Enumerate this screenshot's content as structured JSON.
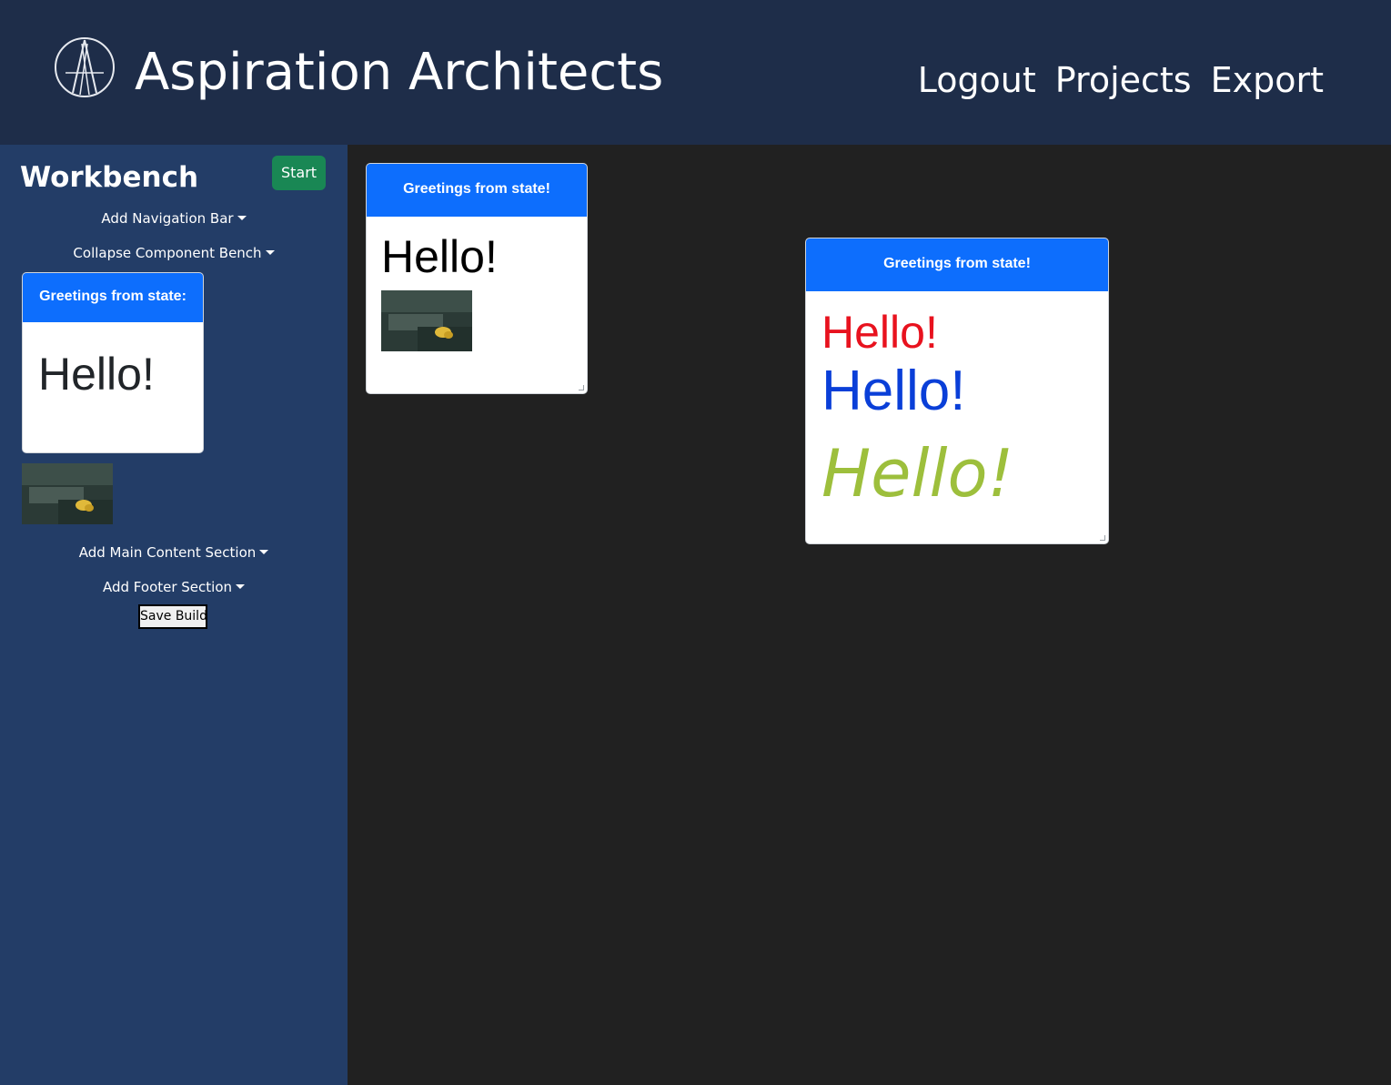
{
  "header": {
    "brand": "Aspiration Architects",
    "logo_icon": "aa-monogram-logo-icon",
    "nav": [
      "Logout",
      "Projects",
      "Export"
    ]
  },
  "sidebar": {
    "title": "Workbench",
    "start_label": "Start",
    "dropdowns": {
      "nav_bar": "Add Navigation Bar",
      "collapse": "Collapse Component Bench",
      "main_content": "Add Main Content Section",
      "footer": "Add Footer Section"
    },
    "bench_card": {
      "header": "Greetings from state:",
      "body": "Hello!"
    },
    "save_label": "Save Build"
  },
  "canvas": {
    "card1": {
      "header": "Greetings from state!",
      "body": "Hello!"
    },
    "card2": {
      "header": "Greetings from state!",
      "lines": [
        "Hello!",
        "Hello!",
        "Hello!"
      ],
      "colors": [
        "#e8121e",
        "#0a3fd8",
        "#9dbf3c"
      ]
    }
  },
  "colors": {
    "header_bg": "#1e2d49",
    "sidebar_bg": "#233d67",
    "canvas_bg": "#212121",
    "card_header": "#0d6efd",
    "start_button": "#198754"
  }
}
